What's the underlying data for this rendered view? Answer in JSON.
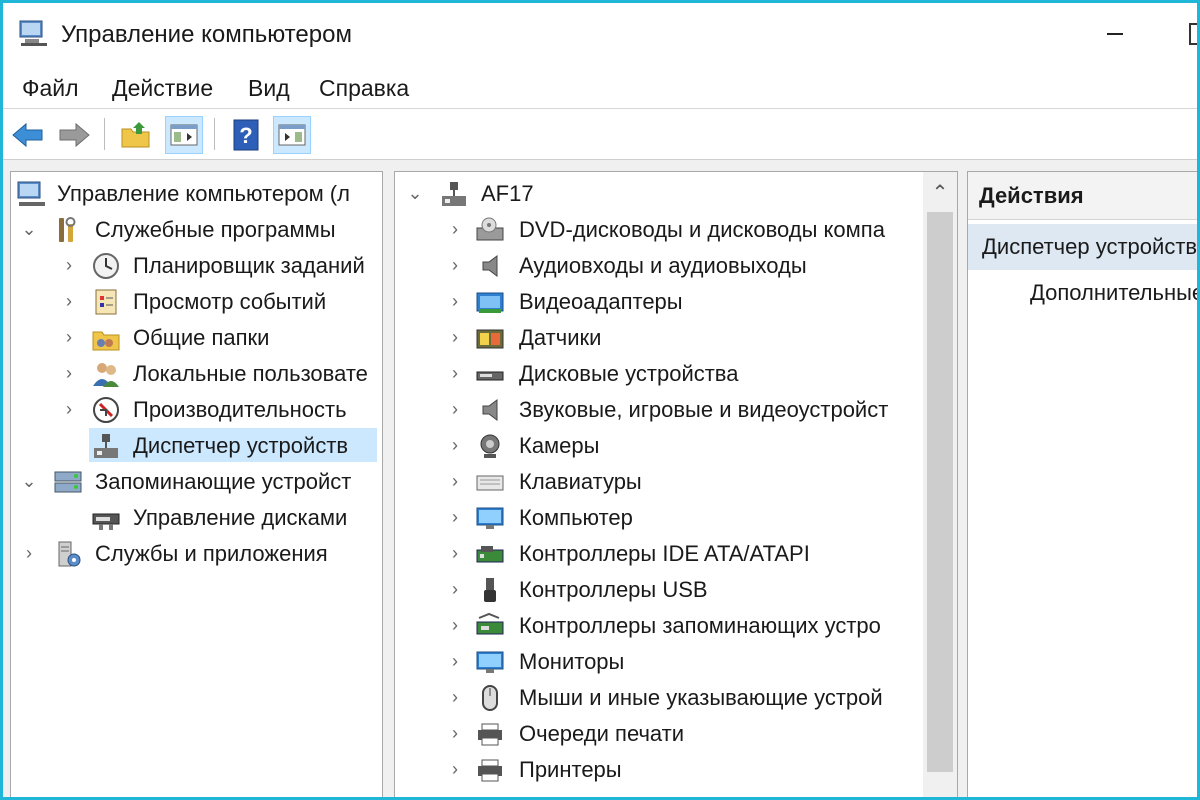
{
  "window": {
    "title": "Управление компьютером"
  },
  "menu": [
    "Файл",
    "Действие",
    "Вид",
    "Справка"
  ],
  "tree": {
    "root": "Управление компьютером (л",
    "items": [
      {
        "label": "Служебные программы",
        "level": 1,
        "expanded": true
      },
      {
        "label": "Планировщик заданий",
        "level": 2,
        "expanded": false
      },
      {
        "label": "Просмотр событий",
        "level": 2,
        "expanded": false
      },
      {
        "label": "Общие папки",
        "level": 2,
        "expanded": false
      },
      {
        "label": "Локальные пользовате",
        "level": 2,
        "expanded": false
      },
      {
        "label": "Производительность",
        "level": 2,
        "expanded": false
      },
      {
        "label": "Диспетчер устройств",
        "level": 2,
        "selected": true
      },
      {
        "label": "Запоминающие устройст",
        "level": 1,
        "expanded": true
      },
      {
        "label": "Управление дисками",
        "level": 2
      },
      {
        "label": "Службы и приложения",
        "level": 1,
        "expanded": false
      }
    ]
  },
  "devices": {
    "computer": "AF17",
    "categories": [
      "DVD-дисководы и дисководы компа",
      "Аудиовходы и аудиовыходы",
      "Видеоадаптеры",
      "Датчики",
      "Дисковые устройства",
      "Звуковые, игровые и видеоустройст",
      "Камеры",
      "Клавиатуры",
      "Компьютер",
      "Контроллеры IDE ATA/ATAPI",
      "Контроллеры USB",
      "Контроллеры запоминающих устро",
      "Мониторы",
      "Мыши и иные указывающие устрой",
      "Очереди печати",
      "Принтеры"
    ]
  },
  "actions": {
    "header": "Действия",
    "section": "Диспетчер устройств",
    "more": "Дополнительные"
  },
  "colors": {
    "frame": "#1fb6d8",
    "selected": "#cce8ff",
    "actions_section": "#dde8f3"
  }
}
